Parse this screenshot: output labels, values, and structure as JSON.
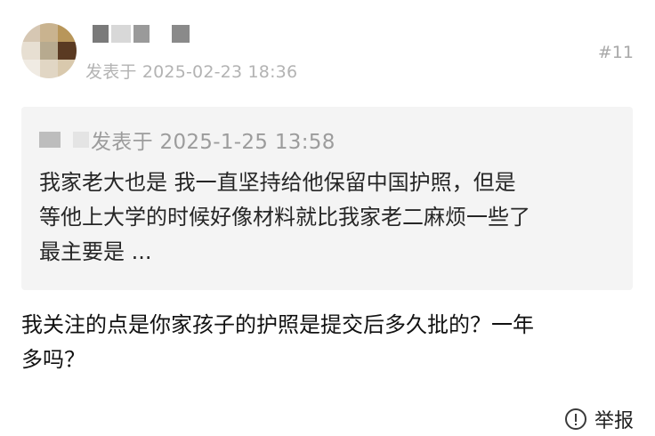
{
  "post": {
    "posted_at": "发表于 2025-02-23 18:36",
    "floor": "#11",
    "avatar_colors": [
      "#d6c7b3",
      "#c9b38f",
      "#b8965a",
      "#e7dfd2",
      "#b7aa8f",
      "#5a3a22",
      "#f0ebe3",
      "#e1d6c4",
      "#d9c9ad"
    ],
    "username_colors": [
      "#7a7a7a",
      "#d8d8d8",
      "#9a9a9a",
      "#ffffff",
      "#ffffff",
      "#8a8a8a"
    ]
  },
  "quote": {
    "posted_at": "发表于 2025-1-25 13:58",
    "lines": [
      "我家老大也是 我一直坚持给他保留中国护照，但是",
      "等他上大学的时候好像材料就比我家老二麻烦一些了",
      "最主要是 ..."
    ]
  },
  "body": {
    "lines": [
      "我关注的点是你家孩子的护照是提交后多久批的？一年",
      "多吗？"
    ]
  },
  "actions": {
    "report_label": "举报",
    "report_icon": "exclamation-circle-icon"
  }
}
